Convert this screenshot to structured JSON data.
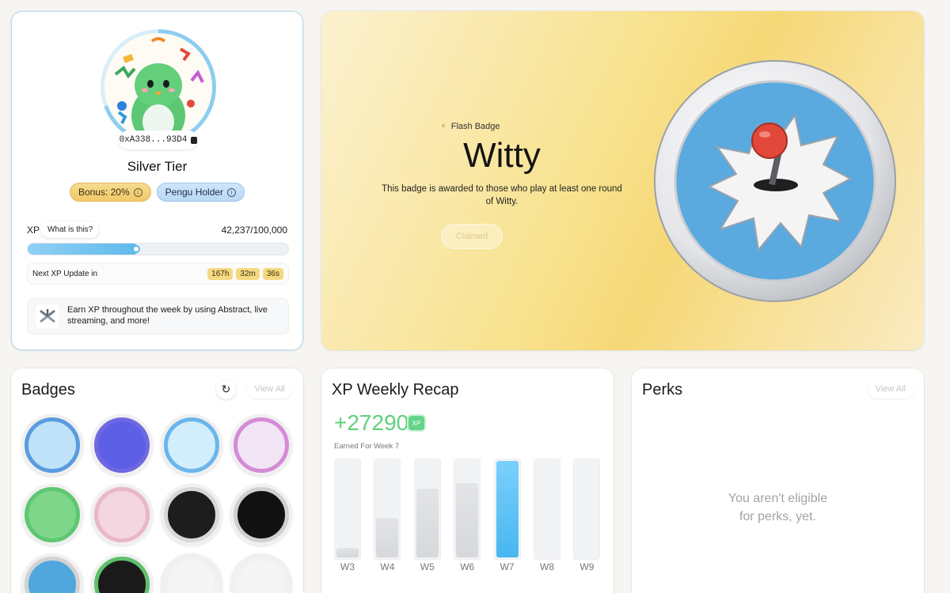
{
  "profile": {
    "address": "0xA338...93D4",
    "tier": "Silver Tier",
    "bonus_label": "Bonus: 20%",
    "holder_label": "Pengu Holder",
    "xp_label": "XP",
    "what_label": "What is this?",
    "xp_value": "42,237/100,000",
    "xp_progress": 0.42237,
    "next_update_label": "Next XP Update in",
    "timer": [
      "167h",
      "32m",
      "36s"
    ],
    "earn_text": "Earn XP throughout the week by using Abstract, live streaming, and more!"
  },
  "hero": {
    "type_label": "Flash Badge",
    "title": "Witty",
    "description": "This badge is awarded to those who play at least one round of Witty.",
    "button_label": "Claimed"
  },
  "badges": {
    "title": "Badges",
    "view_all": "View All",
    "items": [
      {
        "name": "abstract-x-badge",
        "ring": "#5a9be0",
        "inner": "#bfe2f8"
      },
      {
        "name": "discord-badge",
        "ring": "#6f68e0",
        "inner": "#5d60e6"
      },
      {
        "name": "gift-box-badge",
        "ring": "#6ab6ec",
        "inner": "#d2edfb"
      },
      {
        "name": "pink-hand-badge",
        "ring": "#d58ad8",
        "inner": "#f1e4f4"
      },
      {
        "name": "vote-badge",
        "ring": "#5fc772",
        "inner": "#7dd68a"
      },
      {
        "name": "pixel-pink-badge",
        "ring": "#e9b7c6",
        "inner": "#f4d6e0"
      },
      {
        "name": "bridge-badge",
        "ring": "#d8d8d8",
        "inner": "#1d1d1d"
      },
      {
        "name": "gacha-badge",
        "ring": "#cfcfcf",
        "inner": "#111111"
      },
      {
        "name": "joystick-badge",
        "ring": "#d2d2d2",
        "inner": "#4fa7dd"
      },
      {
        "name": "pixel-green-badge",
        "ring": "#5fbf6b",
        "inner": "#1a1a1a"
      },
      {
        "name": "locked-badge-1",
        "ring": "#f1f1f1",
        "inner": "#f5f5f5"
      },
      {
        "name": "locked-badge-2",
        "ring": "#f1f1f1",
        "inner": "#f5f5f5"
      }
    ]
  },
  "recap": {
    "title": "XP Weekly Recap",
    "total": "+27290",
    "xp_chip": "XP",
    "earned_label": "Earned For Week 7",
    "weeks": [
      "W3",
      "W4",
      "W5",
      "W6",
      "W7",
      "W8",
      "W9"
    ],
    "values": [
      0.1,
      0.4,
      0.7,
      0.76,
      0.98,
      0,
      0
    ],
    "active_index": 4
  },
  "perks": {
    "title": "Perks",
    "view_all": "View All",
    "message_line1": "You aren't eligible",
    "message_line2": "for perks, yet."
  },
  "colors": {
    "accent_blue": "#5fb9ea",
    "xp_green": "#5fd07c",
    "gold": "#f0c969"
  }
}
